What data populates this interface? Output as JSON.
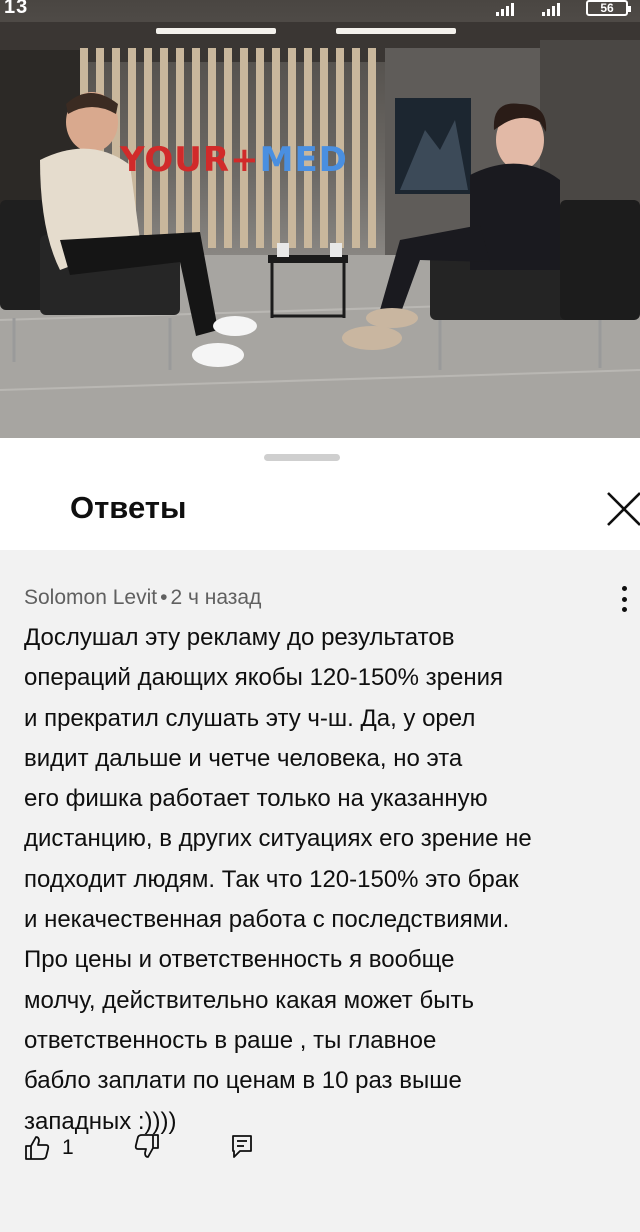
{
  "status_bar": {
    "time": "13",
    "battery": "56"
  },
  "video": {
    "logo_your": "YOUR",
    "logo_plus": "+",
    "logo_med": "MED"
  },
  "sheet": {
    "title": "Ответы",
    "close_icon": "close-icon"
  },
  "comment": {
    "author": "Solomon Levit",
    "separator": "•",
    "time_ago": "2 ч назад",
    "text_lines": [
      "Дослушал эту рекламу до результатов",
      "операций дающих якобы 120-150% зрения",
      "и прекратил слушать эту ч-ш. Да, у орел",
      "видит дальше и четче человека, но эта",
      "его фишка работает только на указанную",
      "дистанцию, в других ситуациях его зрение не",
      "подходит людям. Так что 120-150% это брак",
      "и некачественная работа с последствиями.",
      "Про цены и ответственность я вообще",
      "молчу, действительно какая может быть",
      "ответственность в раше , ты главное",
      "бабло заплати по ценам в 10 раз выше",
      "западных :))))"
    ],
    "like_count": "1",
    "icons": {
      "like": "thumb-up-icon",
      "dislike": "thumb-down-icon",
      "reply": "reply-icon",
      "more": "more-vertical-icon"
    }
  }
}
